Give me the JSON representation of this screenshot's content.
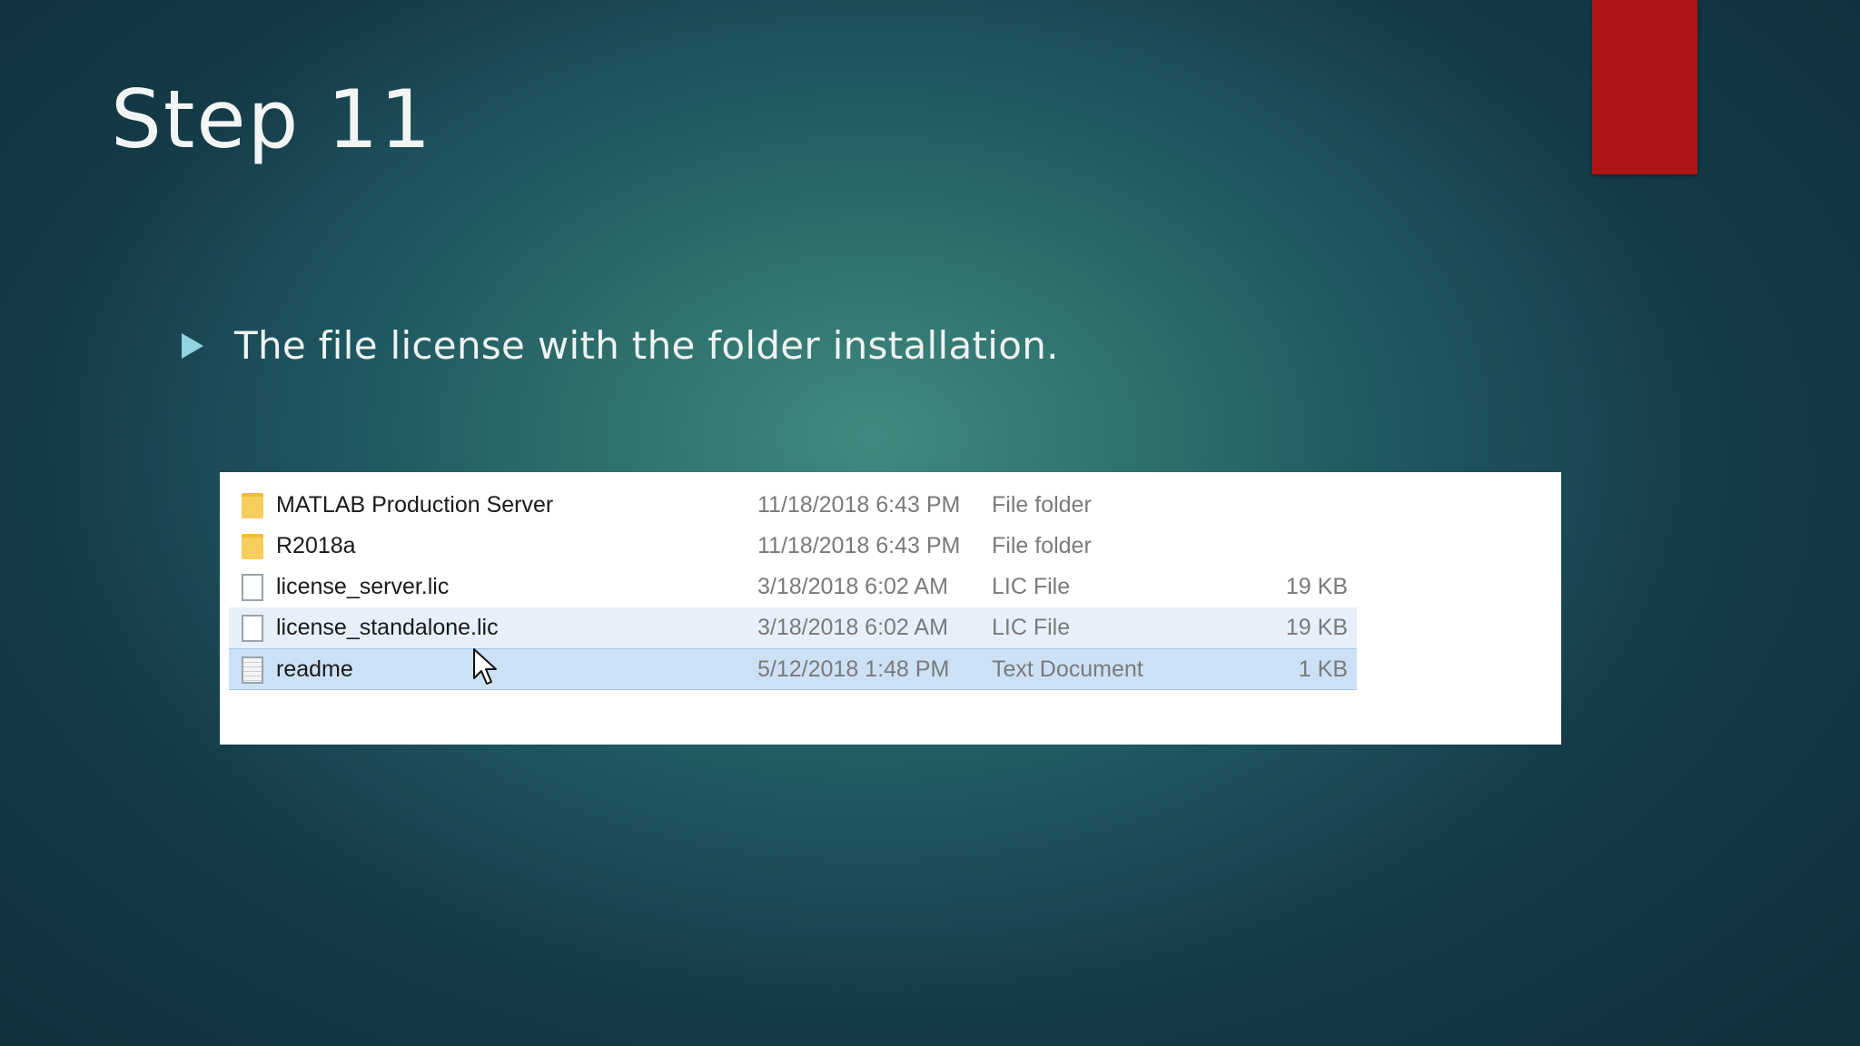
{
  "slide": {
    "title": "Step 11",
    "bullet": "The file license with the folder installation."
  },
  "colors": {
    "accent_bar": "#b01515",
    "bullet": "#8fd4df",
    "background": "#2e6f6b",
    "selection": "#cce1f6"
  },
  "explorer": {
    "rows": [
      {
        "icon": "folder-icon",
        "name": "MATLAB Production Server",
        "date": "11/18/2018 6:43 PM",
        "type": "File folder",
        "size": ""
      },
      {
        "icon": "folder-icon",
        "name": "R2018a",
        "date": "11/18/2018 6:43 PM",
        "type": "File folder",
        "size": ""
      },
      {
        "icon": "file-icon",
        "name": "license_server.lic",
        "date": "3/18/2018 6:02 AM",
        "type": "LIC File",
        "size": "19 KB"
      },
      {
        "icon": "file-icon",
        "name": "license_standalone.lic",
        "date": "3/18/2018 6:02 AM",
        "type": "LIC File",
        "size": "19 KB"
      },
      {
        "icon": "text-document-icon",
        "name": "readme",
        "date": "5/12/2018 1:48 PM",
        "type": "Text Document",
        "size": "1 KB"
      }
    ]
  }
}
